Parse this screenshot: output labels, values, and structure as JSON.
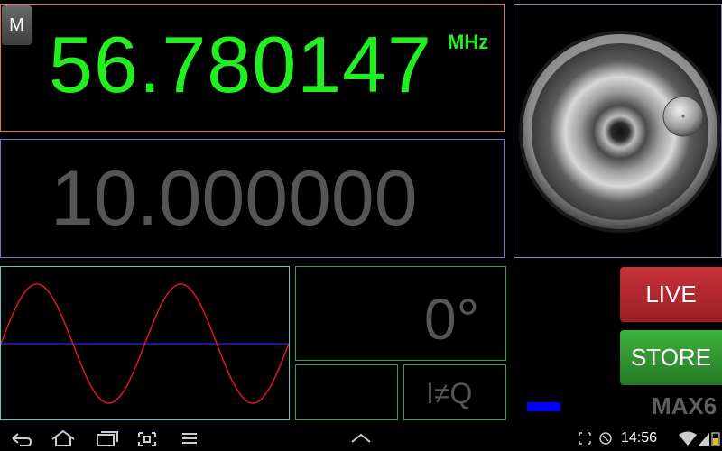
{
  "app": {
    "mode_button": "M"
  },
  "frequency": {
    "value": "56.780147",
    "unit": "MHz"
  },
  "step": {
    "value": "10.000000"
  },
  "phase": {
    "value": "0°"
  },
  "iq": {
    "label": "I≠Q"
  },
  "buttons": {
    "live": "LIVE",
    "store": "STORE"
  },
  "device": {
    "label": "MAX6"
  },
  "level_meter": {
    "color": "#0000ff"
  },
  "colors": {
    "frequency_text": "#22ee22",
    "inactive_text": "#555555",
    "live_button": "#b8282f",
    "store_button": "#33a033",
    "wave": "#e01818",
    "baseline": "#2020d0"
  },
  "waveform": {
    "type": "sine",
    "cycles": 2
  },
  "status_bar": {
    "time": "14:56",
    "icons": [
      "screenshot-icon",
      "sync-icon",
      "alarm-icon",
      "wifi-icon",
      "signal-icon",
      "battery-icon"
    ]
  },
  "nav_bar": {
    "icons": [
      "back-icon",
      "home-icon",
      "recent-apps-icon",
      "screenshot-icon",
      "menu-icon",
      "chevron-up-icon"
    ]
  }
}
